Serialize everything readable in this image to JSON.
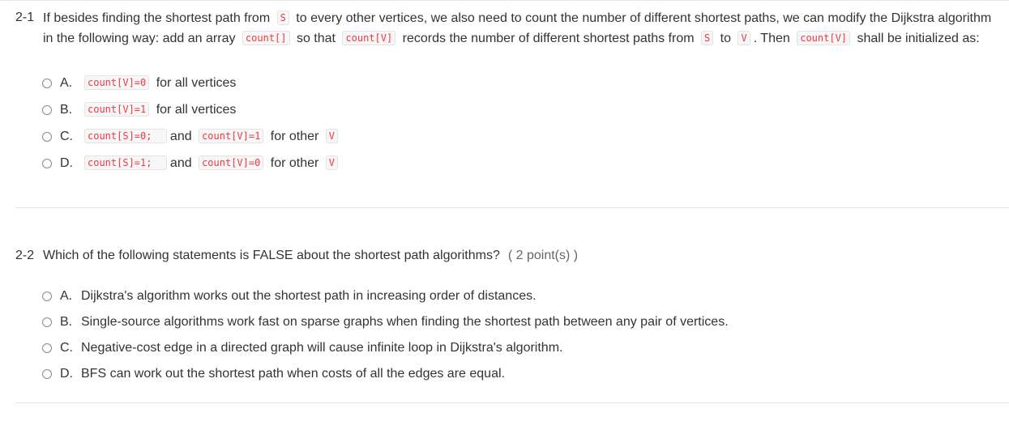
{
  "questions": [
    {
      "number": "2-1",
      "text_parts": [
        {
          "t": "If besides finding the shortest path from "
        },
        {
          "code": "S"
        },
        {
          "t": " to every other vertices, we also need to count the number of different shortest paths, we can modify the Dijkstra algorithm in the following way: add an array "
        },
        {
          "code": "count[]"
        },
        {
          "t": " so that "
        },
        {
          "code": "count[V]"
        },
        {
          "t": " records the number of different shortest paths from "
        },
        {
          "code": "S"
        },
        {
          "t": " to "
        },
        {
          "code": "V"
        },
        {
          "t": ". Then "
        },
        {
          "code": "count[V]"
        },
        {
          "t": " shall be initialized as:"
        }
      ],
      "points": "",
      "options": [
        {
          "letter": "A.",
          "parts": [
            {
              "code": "count[V]=0"
            },
            {
              "t": " for all vertices"
            }
          ]
        },
        {
          "letter": "B.",
          "parts": [
            {
              "code": "count[V]=1"
            },
            {
              "t": " for all vertices"
            }
          ]
        },
        {
          "letter": "C.",
          "parts": [
            {
              "code": "count[S]=0;  "
            },
            {
              "t": "and "
            },
            {
              "code": "count[V]=1"
            },
            {
              "t": " for other "
            },
            {
              "code": "V"
            }
          ]
        },
        {
          "letter": "D.",
          "parts": [
            {
              "code": "count[S]=1;  "
            },
            {
              "t": "and "
            },
            {
              "code": "count[V]=0"
            },
            {
              "t": " for other "
            },
            {
              "code": "V"
            }
          ]
        }
      ]
    },
    {
      "number": "2-2",
      "text_parts": [
        {
          "t": "Which of the following statements is FALSE about the shortest path algorithms?"
        }
      ],
      "points": "( 2 point(s) )",
      "options": [
        {
          "letter": "A.",
          "parts": [
            {
              "t": "Dijkstra's algorithm works out the shortest path in increasing order of distances."
            }
          ]
        },
        {
          "letter": "B.",
          "parts": [
            {
              "t": "Single-source algorithms work fast on sparse graphs when finding the shortest path between any pair of vertices."
            }
          ]
        },
        {
          "letter": "C.",
          "parts": [
            {
              "t": "Negative-cost edge in a directed graph will cause infinite loop in Dijkstra's algorithm."
            }
          ]
        },
        {
          "letter": "D.",
          "parts": [
            {
              "t": "BFS can work out the shortest path when costs of all the edges are equal."
            }
          ]
        }
      ]
    }
  ],
  "icons": {
    "radio": "radio-unchecked-icon"
  },
  "colors": {
    "code_text": "#f0383d",
    "code_bg": "#f7f7f7",
    "text": "#333333",
    "points": "#666666",
    "divider": "#e4e4e4"
  }
}
